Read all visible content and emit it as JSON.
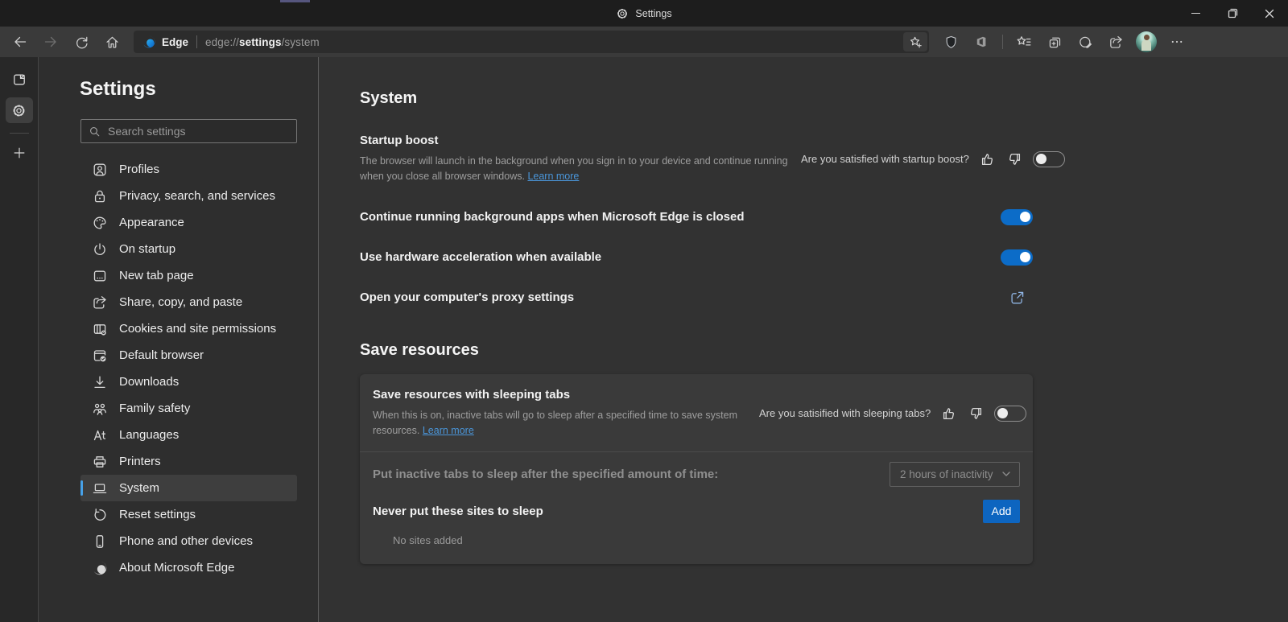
{
  "titlebar": {
    "tab_label": "Settings"
  },
  "toolbar": {
    "brand": "Edge",
    "url_scheme": "edge://",
    "url_highlight": "settings",
    "url_path": "/system"
  },
  "sidebar": {
    "title": "Settings",
    "search_placeholder": "Search settings",
    "items": [
      {
        "label": "Profiles",
        "icon": "profiles-icon"
      },
      {
        "label": "Privacy, search, and services",
        "icon": "privacy-lock-icon"
      },
      {
        "label": "Appearance",
        "icon": "appearance-palette-icon"
      },
      {
        "label": "On startup",
        "icon": "power-icon"
      },
      {
        "label": "New tab page",
        "icon": "new-tab-page-icon"
      },
      {
        "label": "Share, copy, and paste",
        "icon": "share-icon"
      },
      {
        "label": "Cookies and site permissions",
        "icon": "cookies-permissions-icon"
      },
      {
        "label": "Default browser",
        "icon": "default-browser-icon"
      },
      {
        "label": "Downloads",
        "icon": "download-icon"
      },
      {
        "label": "Family safety",
        "icon": "family-icon"
      },
      {
        "label": "Languages",
        "icon": "languages-icon"
      },
      {
        "label": "Printers",
        "icon": "printer-icon"
      },
      {
        "label": "System",
        "icon": "laptop-icon",
        "active": true
      },
      {
        "label": "Reset settings",
        "icon": "reset-icon"
      },
      {
        "label": "Phone and other devices",
        "icon": "phone-icon"
      },
      {
        "label": "About Microsoft Edge",
        "icon": "edge-logo-icon"
      }
    ]
  },
  "main": {
    "page_title": "System",
    "startup_boost": {
      "title": "Startup boost",
      "description": "The browser will launch in the background when you sign in to your device and continue running when you close all browser windows.",
      "learn_more": "Learn more",
      "feedback_question": "Are you satisfied with startup boost?",
      "toggle_state": "off"
    },
    "background_apps": {
      "label": "Continue running background apps when Microsoft Edge is closed",
      "toggle_state": "on"
    },
    "hardware_acceleration": {
      "label": "Use hardware acceleration when available",
      "toggle_state": "on"
    },
    "proxy": {
      "label": "Open your computer's proxy settings"
    },
    "save_resources": {
      "section_title": "Save resources",
      "sleeping_tabs": {
        "title": "Save resources with sleeping tabs",
        "description": "When this is on, inactive tabs will go to sleep after a specified time to save system resources.",
        "learn_more": "Learn more",
        "feedback_question": "Are you satisified with sleeping tabs?",
        "toggle_state": "off"
      },
      "sleep_timeout": {
        "label": "Put inactive tabs to sleep after the specified amount of time:",
        "selected_value": "2 hours of inactivity"
      },
      "never_sleep": {
        "label": "Never put these sites to sleep",
        "add_button": "Add"
      },
      "empty_state": "No sites added"
    }
  },
  "colors": {
    "accent_button_blue": "#0d65c0",
    "toggle_on_blue": "#0c6cc8",
    "link_blue": "#4a96da",
    "active_indicator_blue": "#47a1e8"
  }
}
